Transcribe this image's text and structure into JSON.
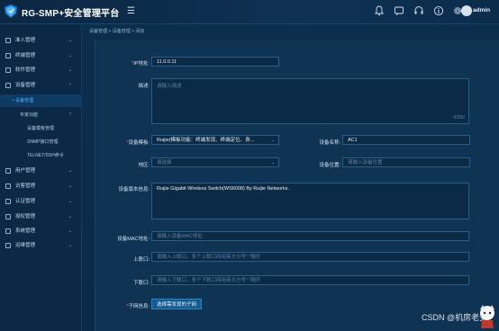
{
  "header": {
    "app_title": "RG-SMP+安全管理平台",
    "menu_toggle": "☰",
    "user_name": "admin",
    "icons": [
      "notification-icon",
      "message-icon",
      "headset-icon",
      "info-icon",
      "gear-icon"
    ]
  },
  "sidebar": {
    "items": [
      {
        "label": "准入管理",
        "icon": "access-icon"
      },
      {
        "label": "终端管理",
        "icon": "terminal-icon"
      },
      {
        "label": "软件管理",
        "icon": "software-icon"
      },
      {
        "label": "设备管理",
        "icon": "device-icon"
      },
      {
        "label": "用户管理",
        "icon": "user-icon"
      },
      {
        "label": "访客管理",
        "icon": "visitor-icon"
      },
      {
        "label": "认证管理",
        "icon": "auth-icon"
      },
      {
        "label": "授权管理",
        "icon": "authorize-icon"
      },
      {
        "label": "系统管理",
        "icon": "system-icon"
      },
      {
        "label": "运维管理",
        "icon": "ops-icon"
      }
    ],
    "device_sub": {
      "device_manage": "• 设备管理",
      "special_function": "专家功能",
      "template_manage": "设备模板管理",
      "snmp_manage": "SNMP接口管理",
      "telnet_cmd": "TELNET/SSH命令"
    }
  },
  "breadcrumb": "设备管理 > 设备管理 > 添加",
  "form": {
    "ip_label": "IP地址:",
    "ip_value": "11.0.0.11",
    "desc_label": "描述:",
    "desc_placeholder": "请输入描述",
    "desc_counter": "0/250",
    "template_label": "设备模板:",
    "template_value": "Ruijie(模板功能：终端发现、终端定位、身...",
    "device_name_label": "设备名称:",
    "device_name_value": "AC1",
    "area_label": "地区:",
    "area_placeholder": "请选择",
    "location_label": "设备位置:",
    "location_placeholder": "请输入设备位置",
    "version_label": "设备版本信息:",
    "version_value": "Ruijie Gigabit Wireless Switch(WS6008) By Ruijie Networks.",
    "mac_label": "设备MAC地址:",
    "mac_placeholder": "请输入设备MAC地址",
    "uplink_label": "上联口:",
    "uplink_placeholder": "请输入上联口，多个上联口间用英文分号\";\"隔开",
    "downlink_label": "下联口:",
    "downlink_placeholder": "请输入下联口，多个下联口间用英文分号\";\"隔开",
    "subnet_label": "子网信息:",
    "subnet_button": "选择需发现的子网"
  },
  "watermark": "CSDN @机房老安"
}
